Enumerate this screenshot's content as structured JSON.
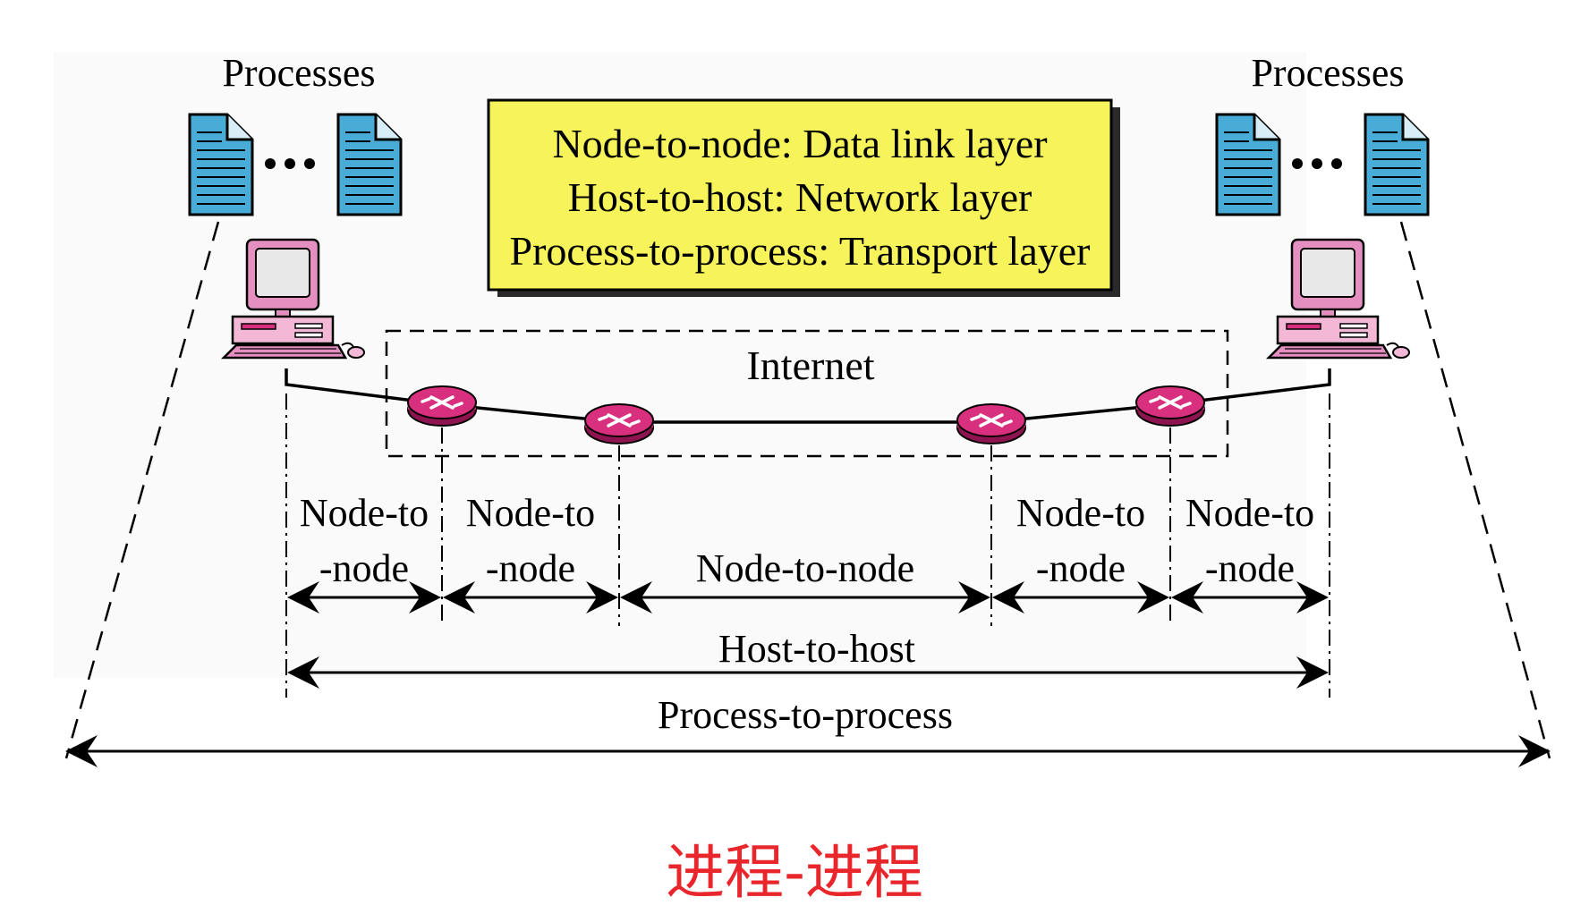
{
  "processes_label_left": "Processes",
  "processes_label_right": "Processes",
  "legend": {
    "line1": "Node-to-node: Data link layer",
    "line2": "Host-to-host: Network layer",
    "line3": "Process-to-process: Transport layer"
  },
  "internet_label": "Internet",
  "segments": [
    {
      "top": "Node-to",
      "bottom": "-node"
    },
    {
      "top": "Node-to",
      "bottom": "-node"
    },
    {
      "top": "Node-to-node",
      "bottom": ""
    },
    {
      "top": "Node-to",
      "bottom": "-node"
    },
    {
      "top": "Node-to",
      "bottom": "-node"
    }
  ],
  "host_to_host": "Host-to-host",
  "process_to_process": "Process-to-process",
  "caption": "进程-进程",
  "colors": {
    "legend_fill": "#f7f35a",
    "document_fill": "#49acd6",
    "router_fill": "#d8307e",
    "computer_accent": "#e58fc0",
    "caption": "#e8262b"
  }
}
